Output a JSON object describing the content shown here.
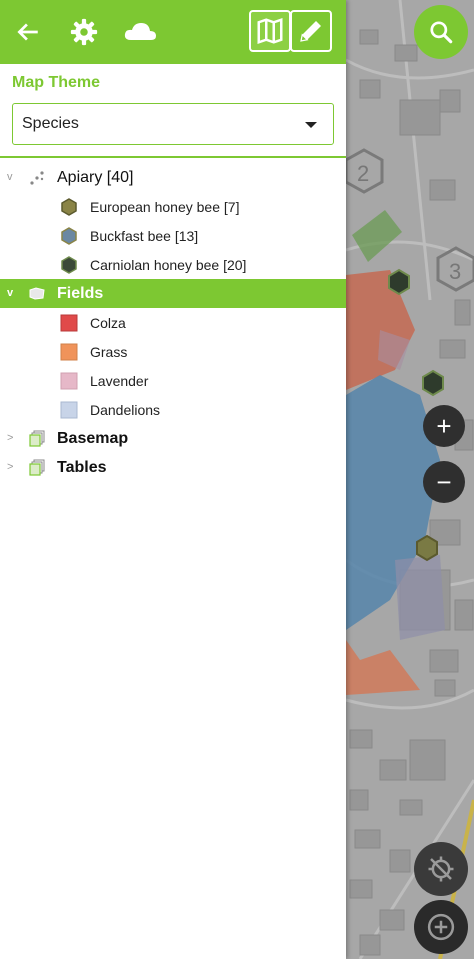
{
  "toolbar": {
    "back_icon": "arrow-back-icon",
    "settings_icon": "gear-icon",
    "cloud_icon": "cloud-icon",
    "map_icon": "map-icon",
    "edit_icon": "pencil-icon"
  },
  "theme": {
    "label": "Map Theme",
    "selected": "Species"
  },
  "tree": {
    "groups": [
      {
        "label": "Apiary [40]",
        "expanded": true,
        "chevron": "v",
        "icon": "point-layer-icon",
        "children": [
          {
            "label": "European honey bee [7]",
            "symbol": "hexagon",
            "fill": "#8a8446",
            "stroke": "#5b5a2e"
          },
          {
            "label": "Buckfast bee [13]",
            "symbol": "hexagon",
            "fill": "#6b88a2",
            "stroke": "#8a8446"
          },
          {
            "label": "Carniolan honey bee [20]",
            "symbol": "hexagon",
            "fill": "#3b4a38",
            "stroke": "#6e8a4c"
          }
        ]
      },
      {
        "label": "Fields",
        "expanded": true,
        "active": true,
        "chevron": "v",
        "icon": "polygon-layer-icon",
        "children": [
          {
            "label": "Colza",
            "symbol": "square",
            "fill": "#e04a4a"
          },
          {
            "label": "Grass",
            "symbol": "square",
            "fill": "#f0935a"
          },
          {
            "label": "Lavender",
            "symbol": "square",
            "fill": "#e6b8c8"
          },
          {
            "label": "Dandelions",
            "symbol": "square",
            "fill": "#c8d4e8"
          }
        ]
      },
      {
        "label": "Basemap",
        "expanded": false,
        "chevron": ">",
        "icon": "layers-group-icon",
        "children": []
      },
      {
        "label": "Tables",
        "expanded": false,
        "chevron": ">",
        "icon": "layers-group-icon",
        "children": []
      }
    ]
  },
  "map": {
    "cluster_labels": [
      "2",
      "3"
    ],
    "search_icon": "search-icon",
    "zoom_in_label": "+",
    "zoom_out_label": "−",
    "gps_icon": "location-off-icon",
    "add_icon": "add-circle-icon"
  },
  "colors": {
    "accent": "#7dc832",
    "map_field_blue": "#4a8cc8",
    "map_field_red": "#d05a4a",
    "map_field_orange": "#e07a50",
    "map_field_green": "#6aa84f"
  }
}
